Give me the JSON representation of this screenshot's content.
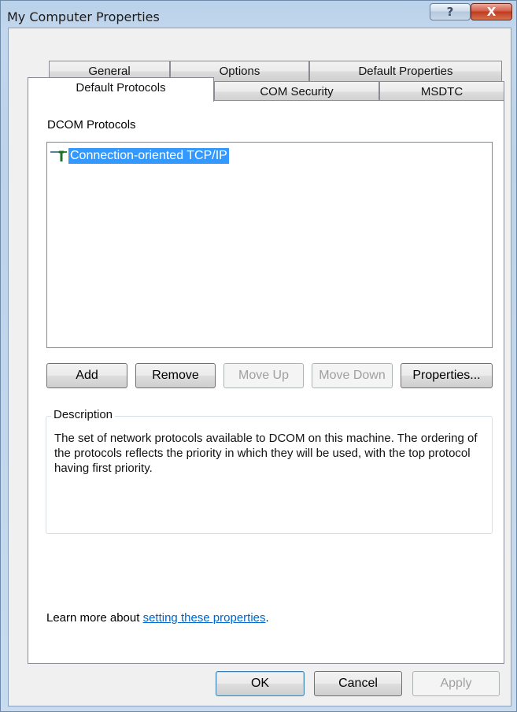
{
  "window": {
    "title": "My Computer Properties",
    "help_glyph": "?",
    "close_glyph": "X"
  },
  "tabs_row1": [
    {
      "label": "General"
    },
    {
      "label": "Options"
    },
    {
      "label": "Default Properties"
    }
  ],
  "tabs_row2": [
    {
      "label": "Default Protocols",
      "active": true
    },
    {
      "label": "COM Security"
    },
    {
      "label": "MSDTC"
    }
  ],
  "protocols": {
    "section_label": "DCOM Protocols",
    "items": [
      {
        "label": "Connection-oriented TCP/IP",
        "selected": true
      }
    ]
  },
  "buttons": {
    "add": "Add",
    "remove": "Remove",
    "move_up": "Move Up",
    "move_down": "Move Down",
    "properties": "Properties..."
  },
  "description": {
    "legend": "Description",
    "text": "The set of network protocols available to DCOM on this machine. The ordering of the protocols reflects the priority in which they will be used, with the top protocol having first priority."
  },
  "learn_more": {
    "prefix": "Learn more about ",
    "link": "setting these properties",
    "suffix": "."
  },
  "dialog_buttons": {
    "ok": "OK",
    "cancel": "Cancel",
    "apply": "Apply"
  },
  "colors": {
    "selection": "#3399ff",
    "link": "#0066cc",
    "close_button": "#c13b20"
  }
}
